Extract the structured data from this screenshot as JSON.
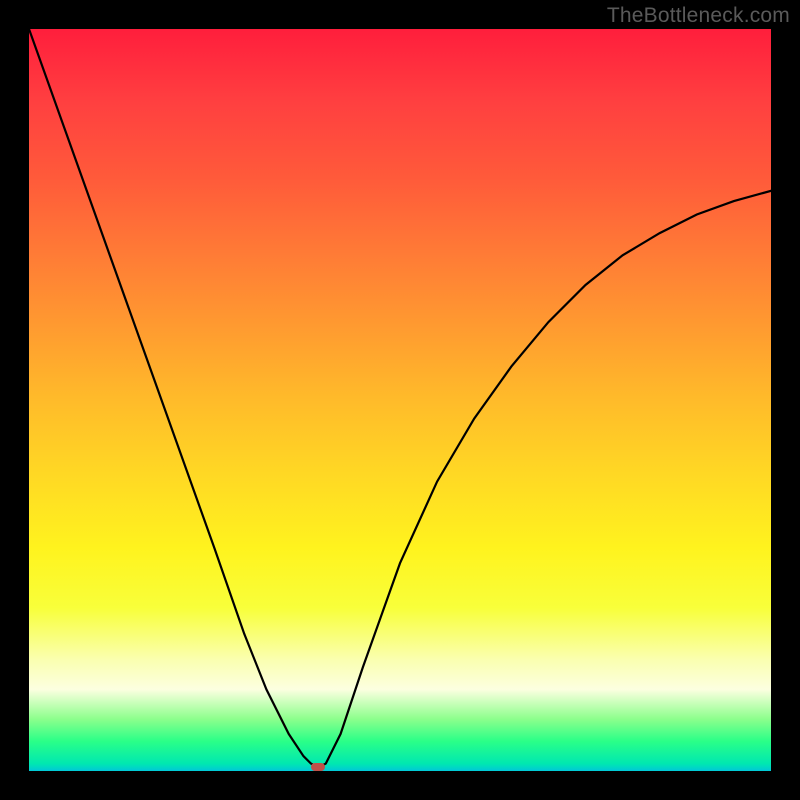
{
  "watermark": "TheBottleneck.com",
  "chart_data": {
    "type": "line",
    "title": "",
    "xlabel": "",
    "ylabel": "",
    "xlim": [
      0,
      1
    ],
    "ylim": [
      0,
      1
    ],
    "background_gradient": {
      "orientation": "vertical",
      "stops": [
        {
          "pos": 0.0,
          "color": "#ff1e3c"
        },
        {
          "pos": 0.5,
          "color": "#ffbb2a"
        },
        {
          "pos": 0.78,
          "color": "#f8ff3a"
        },
        {
          "pos": 0.93,
          "color": "#8cff8c"
        },
        {
          "pos": 1.0,
          "color": "#00c8d8"
        }
      ]
    },
    "series": [
      {
        "name": "bottleneck-curve",
        "color": "#000000",
        "x": [
          0.0,
          0.05,
          0.1,
          0.15,
          0.2,
          0.25,
          0.29,
          0.32,
          0.35,
          0.37,
          0.38,
          0.39,
          0.4,
          0.42,
          0.45,
          0.5,
          0.55,
          0.6,
          0.65,
          0.7,
          0.75,
          0.8,
          0.85,
          0.9,
          0.95,
          1.0
        ],
        "y": [
          1.0,
          0.86,
          0.72,
          0.58,
          0.44,
          0.3,
          0.185,
          0.11,
          0.05,
          0.02,
          0.01,
          0.005,
          0.01,
          0.05,
          0.14,
          0.28,
          0.39,
          0.475,
          0.545,
          0.605,
          0.655,
          0.695,
          0.725,
          0.75,
          0.768,
          0.782
        ]
      }
    ],
    "minimum_marker": {
      "x": 0.39,
      "y": 0.005,
      "color": "#c05048"
    }
  }
}
